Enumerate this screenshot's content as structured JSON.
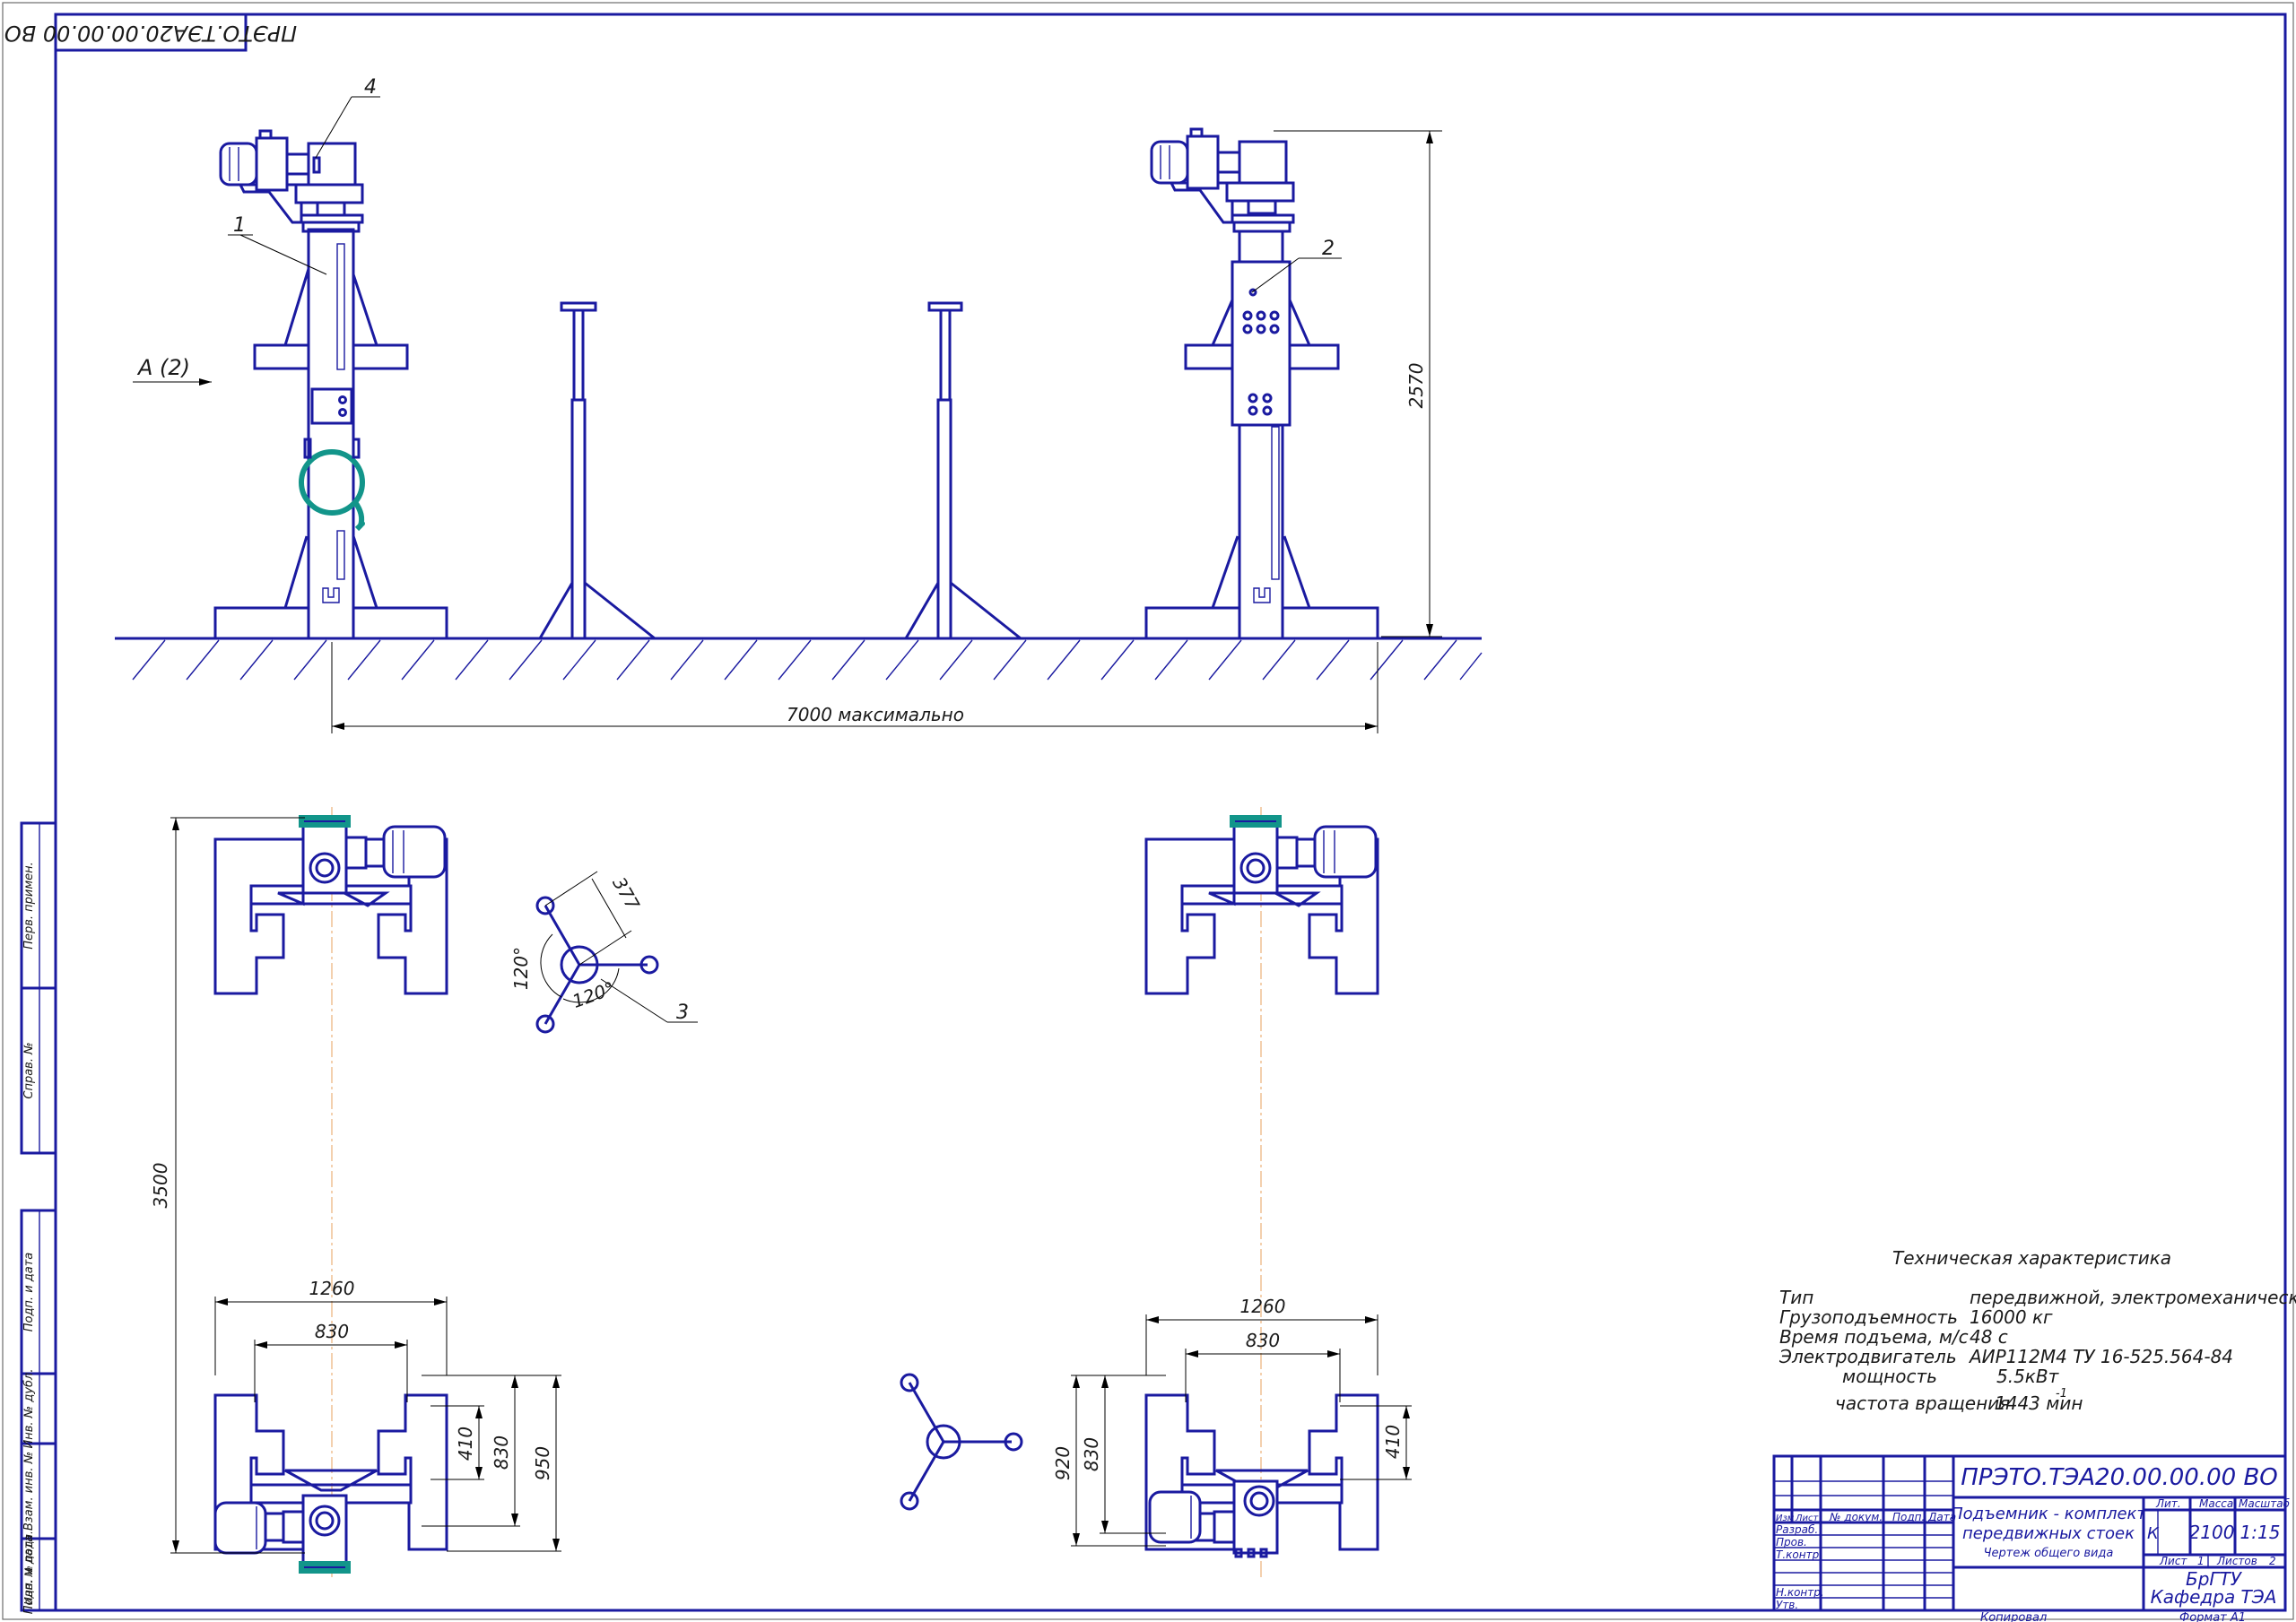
{
  "designation": "ПРЭТО.ТЭА20.00.00.00 ВО",
  "designation_rotated": "ПРЭТО.ТЭА20.00.00.00 ВО",
  "view_label": "А (2)",
  "callouts": [
    "1",
    "2",
    "3",
    "4"
  ],
  "dimensions": {
    "height_stand": "2570",
    "span": "7000 максимально",
    "length_plan": "3500",
    "width_outer_left": "1260",
    "width_inner_left": "830",
    "width_outer_right": "1260",
    "width_inner_right": "830",
    "right_410": "410",
    "right_830": "830",
    "right_950": "950",
    "left_920": "920",
    "left_830": "830",
    "left_410": "410",
    "tripod_377": "377",
    "tripod_angle_a": "120°",
    "tripod_angle_b": "120°"
  },
  "tech": {
    "title": "Техническая характеристика",
    "rows": [
      {
        "label": "Тип",
        "value": "передвижной, электромеханический"
      },
      {
        "label": "Грузоподъемность",
        "value": "16000 кг"
      },
      {
        "label": "Время подъема, м/с",
        "value": "48 с"
      },
      {
        "label": "Электродвигатель",
        "value": "АИР112М4  ТУ 16-525.564-84"
      },
      {
        "label": "мощность",
        "value": "5.5кВт"
      },
      {
        "label": "частота вращения",
        "value": "1443 мин"
      }
    ],
    "exponent": "-1"
  },
  "title_block": {
    "designation": "ПРЭТО.ТЭА20.00.00.00 ВО",
    "name_line1": "Подъемник - комплект",
    "name_line2": "передвижных стоек",
    "doc_type": "Чертеж общего вида",
    "col_headers": [
      "Изм",
      "Лист",
      "№ докум.",
      "Подп.",
      "Дата"
    ],
    "roles": [
      "Разраб.",
      "Пров.",
      "Т.контр.",
      "Н.контр.",
      "Утв."
    ],
    "lit_label": "Лит.",
    "mass_label": "Масса",
    "scale_label": "Масштаб",
    "lit_value": "К",
    "mass_value": "2100",
    "scale_value": "1:15",
    "sheet_label": "Лист",
    "sheet_value": "1",
    "sheets_label": "Листов",
    "sheets_value": "2",
    "org_line1": "БрГТУ",
    "org_line2": "Кафедра ТЭА",
    "copied": "Копировал",
    "format": "Формат   А1"
  },
  "side_stamp": [
    "Перв. примен.",
    "Справ. №",
    "Подп. и дата",
    "Инв. № дубл.",
    "Взам. инв. №",
    "Подп. и дата",
    "Инв. № подл."
  ],
  "colors": {
    "line": "#1a1aa0",
    "accent": "#12958a",
    "axis": "#e7a25c"
  }
}
